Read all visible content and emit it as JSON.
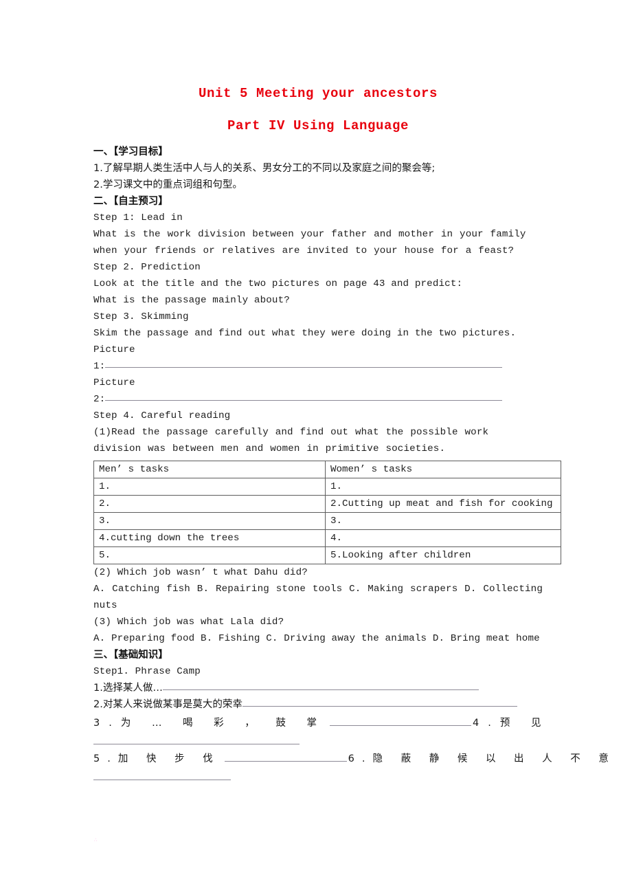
{
  "document": {
    "title_main": "Unit 5 Meeting your ancestors",
    "title_sub": "Part IV  Using Language",
    "title_color": "#e8000d"
  },
  "section_objectives": {
    "heading": "一、【学习目标】",
    "items": [
      "1.了解早期人类生活中人与人的关系、男女分工的不同以及家庭之间的聚会等;",
      "2.学习课文中的重点词组和句型。"
    ]
  },
  "section_preview": {
    "heading": "二、【自主预习】",
    "step1_label": "Step 1: Lead in",
    "step1_question": "What is the work division between your father and mother in your family when your friends or relatives are invited to your house for a feast?",
    "step2_label": "Step 2. Prediction",
    "step2_line1": "Look at the title and the two pictures on page 43 and predict:",
    "step2_line2": "What is the passage mainly about?",
    "step3_label": "Step 3. Skimming",
    "step3_line1": "Skim the passage and find out what they were doing in the two pictures.",
    "picture1_label": "Picture",
    "picture1_number": "1:",
    "picture2_label": "Picture",
    "picture2_number": "2:",
    "step4_label": "Step 4. Careful reading",
    "step4_q1": "(1)Read the passage carefully and find out what the possible work division was between men and women in primitive societies."
  },
  "tasks_table": {
    "headers": [
      "Men’ s tasks",
      "Women’ s tasks"
    ],
    "rows": [
      [
        "1.",
        "1."
      ],
      [
        "2.",
        "2.Cutting up meat and fish for cooking"
      ],
      [
        "3.",
        "3."
      ],
      [
        "4.cutting down the trees",
        "4."
      ],
      [
        "5.",
        "5.Looking after children"
      ]
    ]
  },
  "question2": {
    "stem": "(2) Which job wasn’ t what Dahu did?",
    "options_line": "A. Catching fish     B. Repairing stone tools    C. Making scrapers        D. Collecting nuts"
  },
  "question3": {
    "stem": "(3) Which job was what Lala did?",
    "options_line": "A. Preparing food    B. Fishing       C. Driving away the animals  D. Bring meat home"
  },
  "section_basics": {
    "heading": "三、【基础知识】",
    "step_label": "Step1. Phrase Camp",
    "phrases": [
      {
        "number": "1.",
        "text": "选择某人做…"
      },
      {
        "number": "2.",
        "text": "对某人来说做某事是莫大的荣幸"
      },
      {
        "number": "3.",
        "text": "为 … 喝 彩 ， 鼓 掌"
      },
      {
        "number": "4.",
        "text": "预 见"
      },
      {
        "number": "5.",
        "text": "加 快 步 伐"
      },
      {
        "number": "6.",
        "text": "隐 蔽 静 候 以 出 人 不 意"
      }
    ]
  },
  "artifact": {
    "mark": "∴"
  }
}
